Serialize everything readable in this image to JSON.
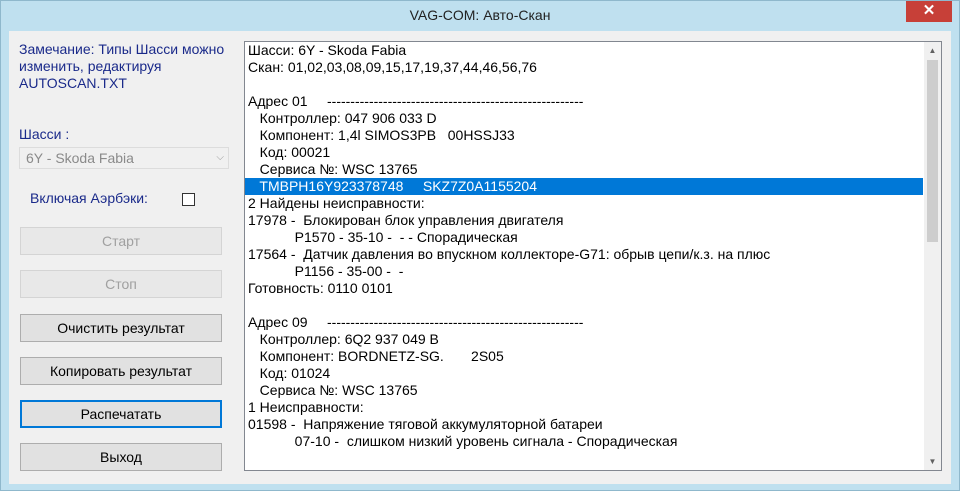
{
  "window": {
    "title": "VAG-COM: Авто-Скан",
    "close_glyph": "✕"
  },
  "left_panel": {
    "note": "Замечание: Типы Шасси можно изменить, редактируя AUTOSCAN.TXT",
    "chassis_label": "Шасси :",
    "chassis_value": "6Y - Skoda Fabia",
    "airbag_label": "Включая Аэрбэки:",
    "airbag_checked": false,
    "buttons": {
      "start": "Старт",
      "stop": "Стоп",
      "clear": "Очистить результат",
      "copy": "Копировать результат",
      "print": "Распечатать",
      "exit": "Выход"
    }
  },
  "output": {
    "lines": [
      "Шасси: 6Y - Skoda Fabia",
      "Скан: 01,02,03,08,09,15,17,19,37,44,46,56,76",
      "",
      "Адрес 01     -------------------------------------------------------",
      "   Контроллер: 047 906 033 D",
      "   Компонент: 1,4l SIMOS3PB   00HSSJ33",
      "   Код: 00021",
      "   Сервиса №: WSC 13765",
      "   TMBPH16Y923378748     SKZ7Z0A1155204",
      "2 Найдены неисправности:",
      "17978 -  Блокирован блок управления двигателя",
      "            P1570 - 35-10 -  - - Спорадическая",
      "17564 -  Датчик давления во впускном коллекторе-G71: обрыв цепи/к.з. на плюс",
      "            P1156 - 35-00 -  -",
      "Готовность: 0110 0101",
      "",
      "Адрес 09     -------------------------------------------------------",
      "   Контроллер: 6Q2 937 049 B",
      "   Компонент: BORDNETZ-SG.       2S05",
      "   Код: 01024",
      "   Сервиса №: WSC 13765",
      "1 Неисправности:",
      "01598 -  Напряжение тяговой аккумуляторной батареи",
      "            07-10 -  слишком низкий уровень сигнала - Спорадическая"
    ],
    "selected_line_index": 8
  }
}
